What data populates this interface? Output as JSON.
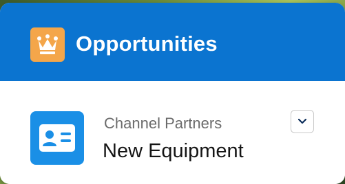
{
  "header": {
    "title": "Opportunities",
    "icon": "crown-icon",
    "icon_bg_color": "#f4a64a",
    "bg_color": "#0b74d0"
  },
  "record": {
    "subtitle": "Channel Partners",
    "title": "New Equipment",
    "icon": "contact-card-icon",
    "icon_bg_color": "#1a8fe6"
  },
  "actions": {
    "dropdown_icon": "chevron-down-icon"
  }
}
